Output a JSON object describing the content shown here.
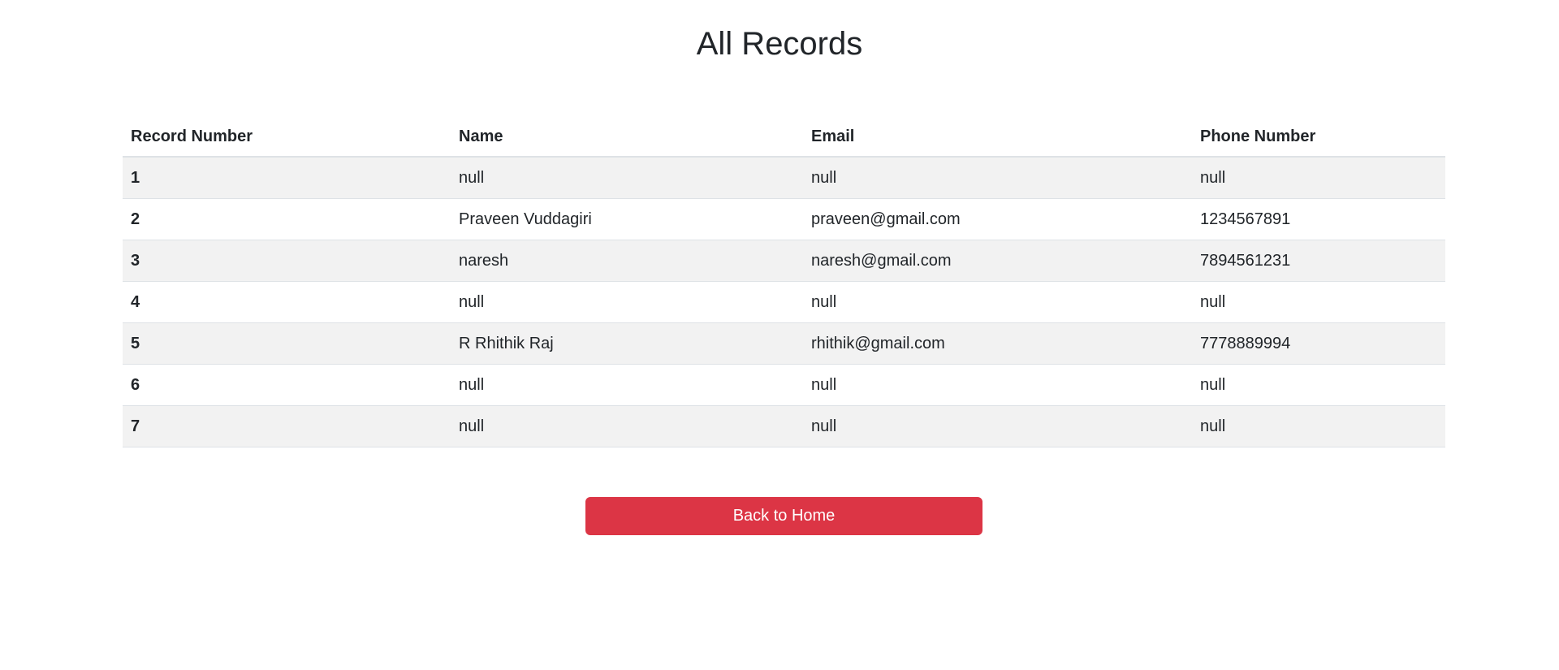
{
  "page": {
    "title": "All Records"
  },
  "table": {
    "headers": [
      "Record Number",
      "Name",
      "Email",
      "Phone Number"
    ],
    "rows": [
      {
        "record_number": "1",
        "name": "null",
        "email": "null",
        "phone": "null"
      },
      {
        "record_number": "2",
        "name": "Praveen Vuddagiri",
        "email": "praveen@gmail.com",
        "phone": "1234567891"
      },
      {
        "record_number": "3",
        "name": "naresh",
        "email": "naresh@gmail.com",
        "phone": "7894561231"
      },
      {
        "record_number": "4",
        "name": "null",
        "email": "null",
        "phone": "null"
      },
      {
        "record_number": "5",
        "name": "R Rhithik Raj",
        "email": "rhithik@gmail.com",
        "phone": "7778889994"
      },
      {
        "record_number": "6",
        "name": "null",
        "email": "null",
        "phone": "null"
      },
      {
        "record_number": "7",
        "name": "null",
        "email": "null",
        "phone": "null"
      }
    ]
  },
  "actions": {
    "back_label": "Back to Home"
  },
  "colors": {
    "accent": "#dc3545",
    "stripe": "#f2f2f2",
    "text": "#212529"
  }
}
